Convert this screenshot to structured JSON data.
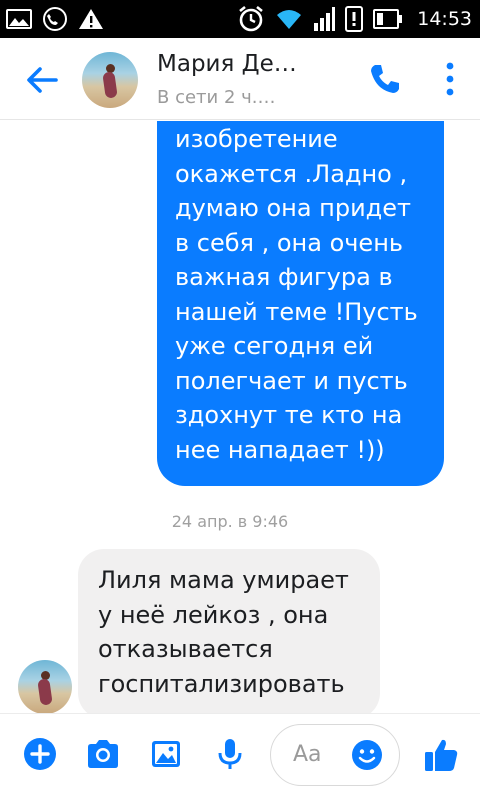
{
  "status_bar": {
    "time": "14:53",
    "left_icons": [
      "gallery-icon",
      "phone-handset-icon",
      "warning-icon"
    ],
    "right_icons": [
      "alarm-clock-icon",
      "wifi-icon",
      "signal-icon",
      "data-icon",
      "battery-icon"
    ]
  },
  "header": {
    "contact_name": "Мария Де…",
    "contact_status": "В сети 2 ч.…"
  },
  "messages": {
    "outgoing_text": "изобретение окажется .Ладно , думаю она придет в себя , она очень важная фигура в нашей теме !Пусть уже сегодня ей полегчает и пусть здохнут те кто на нее нападает !))",
    "timestamp": "24 апр. в 9:46",
    "incoming_text": "Лиля мама умирает у неё лейкоз , она отказывается госпитализировать"
  },
  "composer": {
    "placeholder": "Aa"
  },
  "colors": {
    "accent": "#0a7cff",
    "incoming_bubble": "#f1f0f0"
  }
}
